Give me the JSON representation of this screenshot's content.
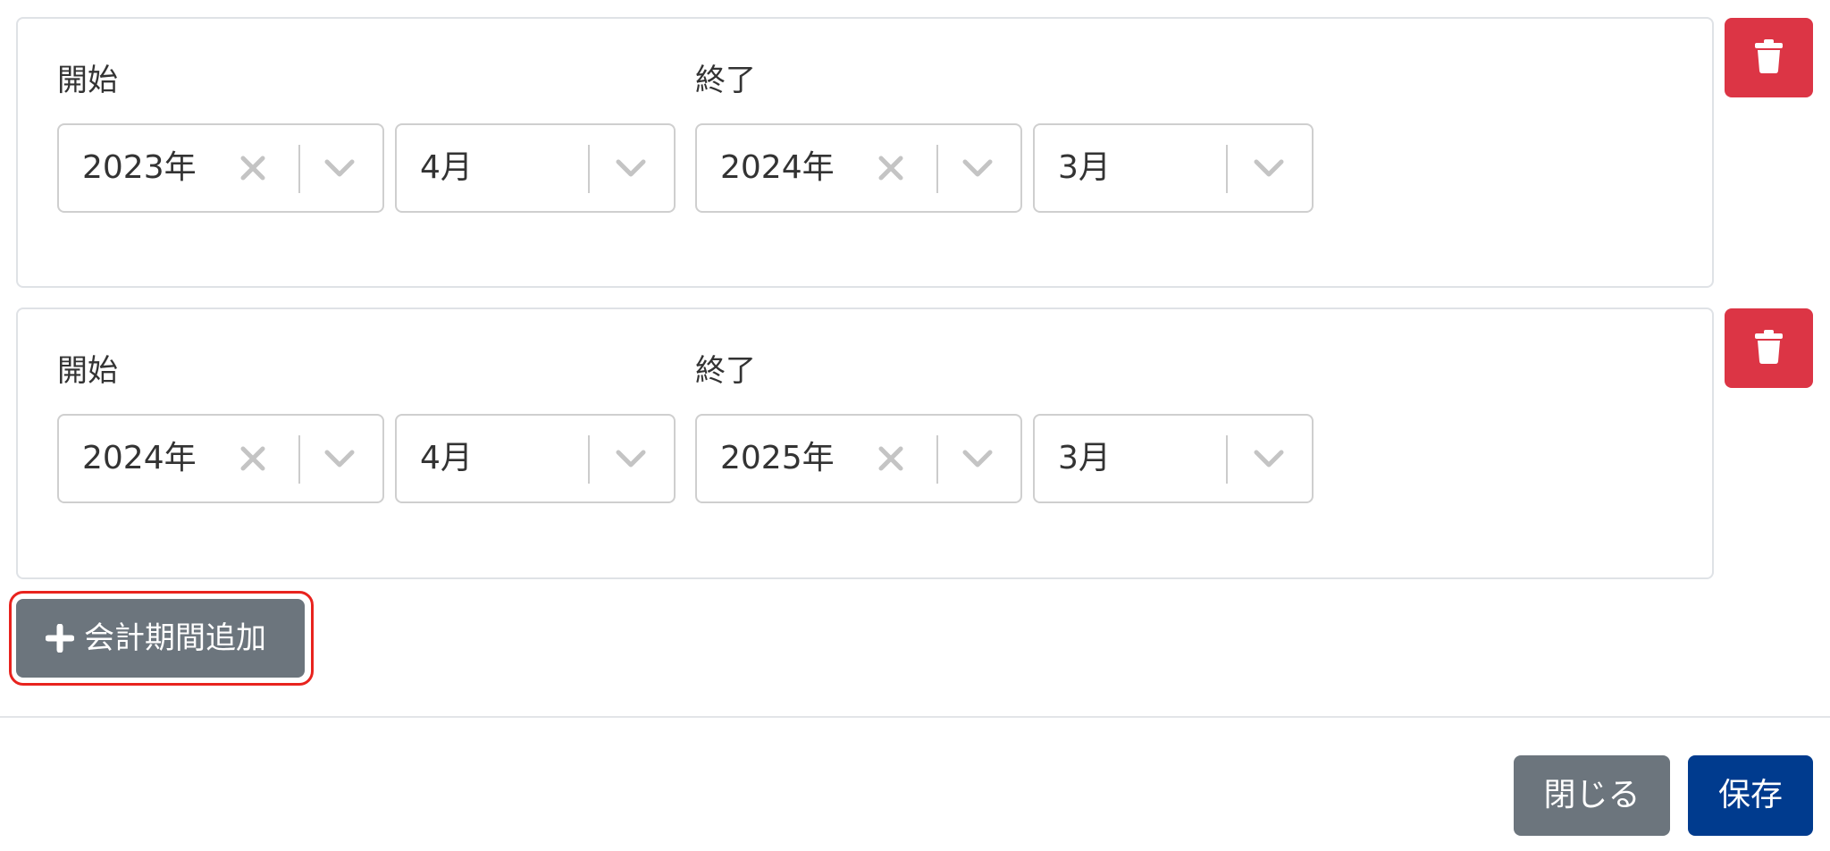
{
  "periods": [
    {
      "start_label": "開始",
      "end_label": "終了",
      "start_year": "2023年",
      "start_month": "4月",
      "end_year": "2024年",
      "end_month": "3月"
    },
    {
      "start_label": "開始",
      "end_label": "終了",
      "start_year": "2024年",
      "start_month": "4月",
      "end_year": "2025年",
      "end_month": "3月"
    }
  ],
  "add_button_label": "会計期間追加",
  "footer": {
    "close_label": "閉じる",
    "save_label": "保存"
  },
  "icons": {
    "delete": "trash-icon",
    "clear": "close-icon",
    "dropdown": "chevron-down-icon",
    "add": "plus-icon"
  },
  "colors": {
    "delete": "#dc3545",
    "secondary": "#6c757d",
    "primary": "#003b8e",
    "highlight": "#e8231e"
  }
}
